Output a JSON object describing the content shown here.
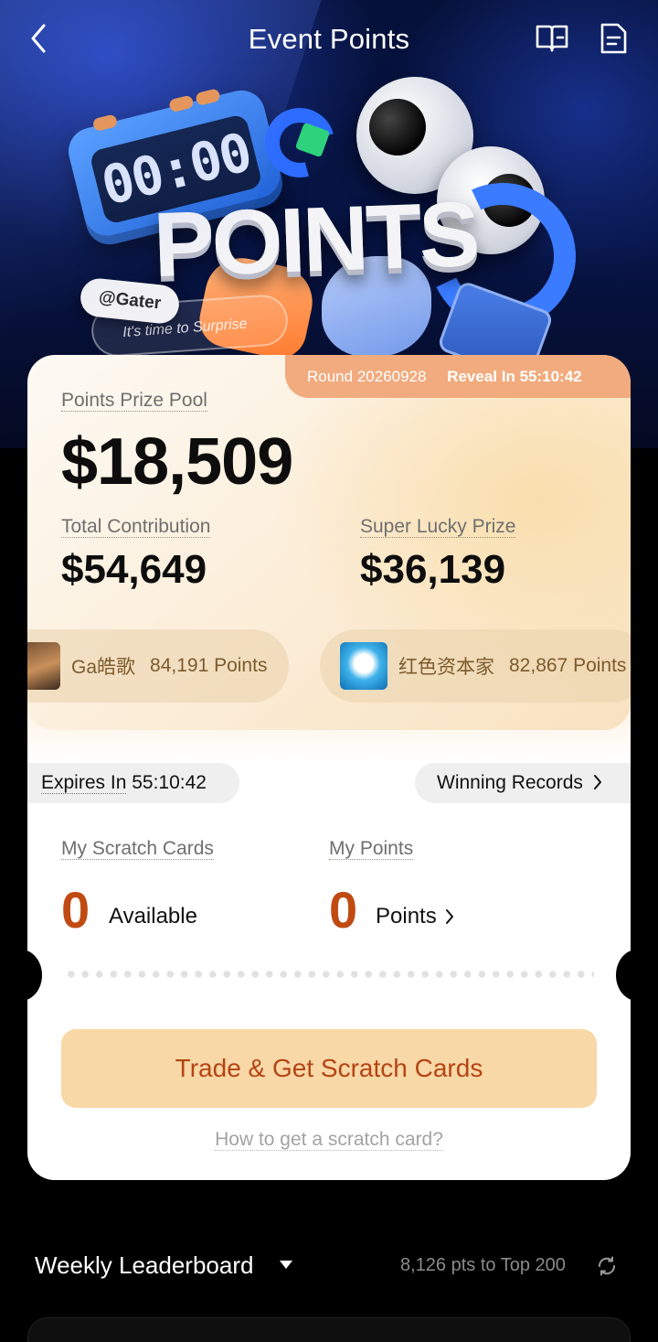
{
  "header": {
    "title": "Event Points",
    "back_icon": "chevron-left-icon",
    "guide_icon": "book-icon",
    "rules_icon": "document-icon"
  },
  "hero": {
    "clock_text": "00:00",
    "headline": "POINTS",
    "tag": "@Gater",
    "tagline": "It's time to Surprise"
  },
  "prize": {
    "round_label": "Round 20260928",
    "reveal_label": "Reveal In 55:10:42",
    "pool_label": "Points Prize Pool",
    "pool_value": "$18,509",
    "contribution_label": "Total Contribution",
    "contribution_value": "$54,649",
    "lucky_label": "Super Lucky Prize",
    "lucky_value": "$36,139",
    "leaders": [
      {
        "name": "Ga皓歌",
        "points": "84,191 Points"
      },
      {
        "name": "红色资本家",
        "points": "82,867 Points"
      }
    ]
  },
  "my": {
    "expires_label": "Expires In",
    "expires_value": "55:10:42",
    "records_label": "Winning Records",
    "cards_label": "My Scratch Cards",
    "cards_value": "0",
    "cards_unit": "Available",
    "points_label": "My Points",
    "points_value": "0",
    "points_unit": "Points",
    "cta_label": "Trade & Get Scratch Cards",
    "howto_label": "How to get a scratch card?"
  },
  "leaderboard": {
    "title": "Weekly Leaderboard",
    "meta": "8,126 pts to Top 200"
  },
  "colors": {
    "accent": "#c04a12",
    "cta_bg": "#f8d8a6",
    "badge_bg": "#f1ab7e"
  }
}
